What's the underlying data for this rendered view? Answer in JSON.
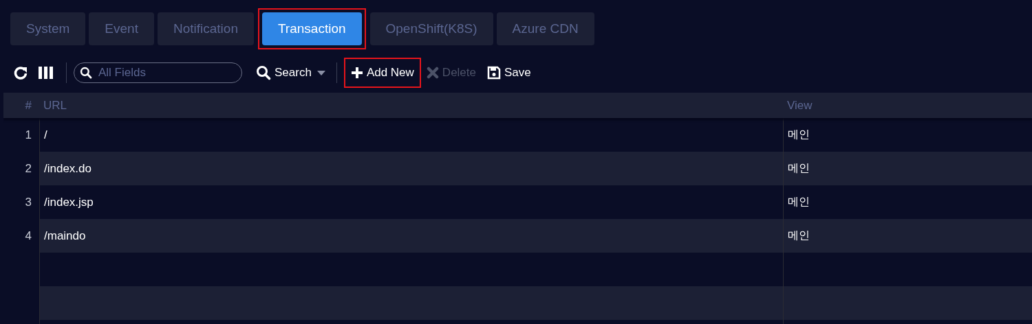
{
  "tabs": [
    {
      "label": "System",
      "selected": false,
      "highlighted": false
    },
    {
      "label": "Event",
      "selected": false,
      "highlighted": false
    },
    {
      "label": "Notification",
      "selected": false,
      "highlighted": false
    },
    {
      "label": "Transaction",
      "selected": true,
      "highlighted": true
    },
    {
      "label": "OpenShift(K8S)",
      "selected": false,
      "highlighted": false
    },
    {
      "label": "Azure CDN",
      "selected": false,
      "highlighted": false
    }
  ],
  "toolbar": {
    "search_field": {
      "placeholder": "All Fields"
    },
    "buttons": [
      {
        "kind": "refresh"
      },
      {
        "kind": "columns"
      },
      {
        "kind": "field"
      },
      {
        "kind": "search",
        "label": "Search"
      },
      {
        "kind": "add",
        "label": "Add New",
        "highlighted": true,
        "disabled": false
      },
      {
        "kind": "delete",
        "label": "Delete",
        "highlighted": false,
        "disabled": true
      },
      {
        "kind": "save",
        "label": "Save",
        "highlighted": false,
        "disabled": false
      }
    ]
  },
  "table": {
    "columns": [
      "#",
      "URL",
      "View"
    ],
    "rows": [
      {
        "number": "1",
        "url": "/",
        "view": "메인"
      },
      {
        "number": "2",
        "url": "/index.do",
        "view": "메인"
      },
      {
        "number": "3",
        "url": "/index.jsp",
        "view": "메인"
      },
      {
        "number": "4",
        "url": "/maindo",
        "view": "메인"
      }
    ]
  }
}
